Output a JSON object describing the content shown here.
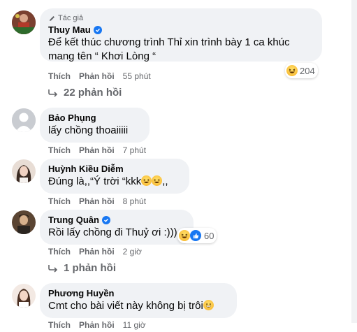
{
  "colors": {
    "bubble_bg": "#f0f2f5",
    "accent": "#1877f2",
    "muted": "#65676b",
    "text": "#050505"
  },
  "comments": [
    {
      "author_badge": "Tác giả",
      "name": "Thuy Mau",
      "verified": true,
      "text_line1": "Để kết thúc chương trình Thỉ xin trình bày 1 ca khúc",
      "text_line2": "mang tên “ Khơi Lòng “",
      "like": "Thích",
      "reply": "Phản hồi",
      "time": "55 phút",
      "reaction_count": "204",
      "replies_label": "22 phản hồi"
    },
    {
      "name": "Bảo Phụng",
      "text": "lấy chồng thoaiiiii",
      "like": "Thích",
      "reply": "Phản hồi",
      "time": "7 phút"
    },
    {
      "name": "Huỳnh Kiều Diễm",
      "text": "Đúng là,,“Ý trời “kkk",
      "text_suffix": ",,",
      "like": "Thích",
      "reply": "Phản hồi",
      "time": "8 phút"
    },
    {
      "name": "Trung Quân",
      "verified": true,
      "text": "Rồi lấy chồng đi Thuỷ ơi :)))",
      "like": "Thích",
      "reply": "Phản hồi",
      "time": "2 giờ",
      "reaction_count": "60",
      "replies_label": "1 phản hồi"
    },
    {
      "name": "Phương Huyền",
      "text": "Cmt cho bài viết này không bị trôi",
      "like": "Thích",
      "reply": "Phản hồi",
      "time": "11 giờ"
    }
  ]
}
